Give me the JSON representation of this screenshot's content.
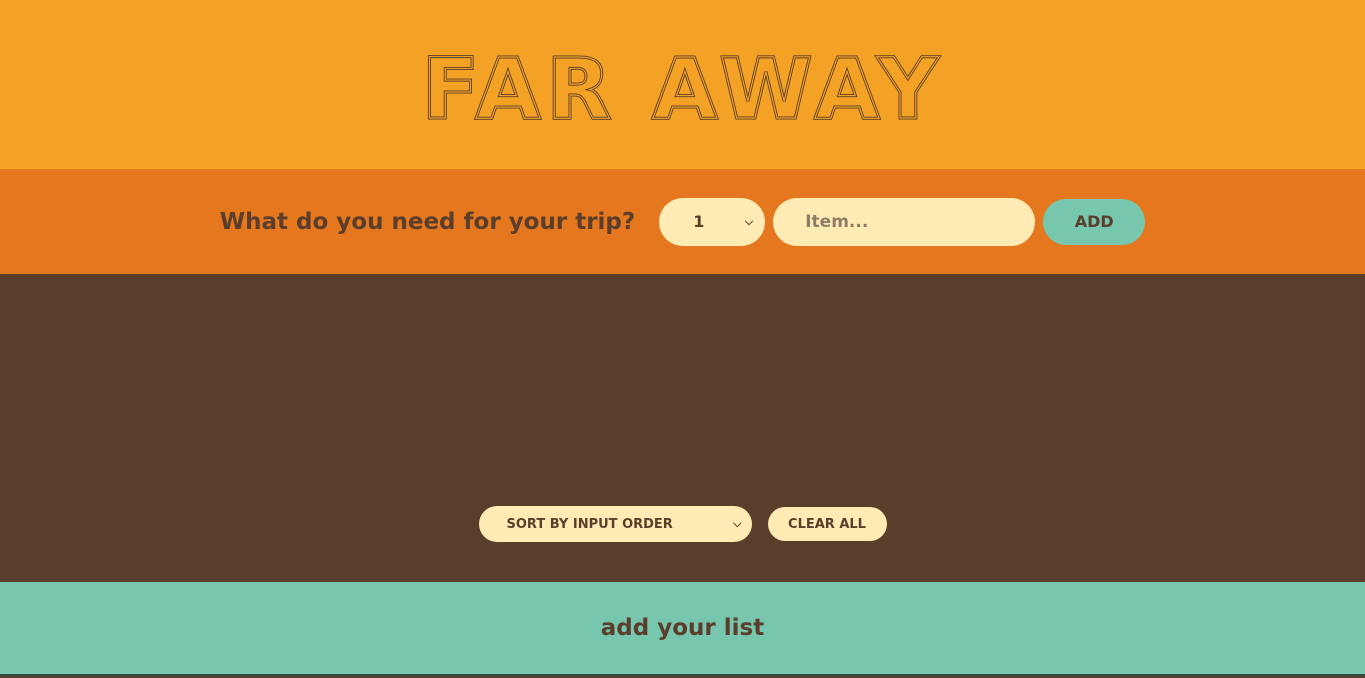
{
  "header": {
    "title": "FAR AWAY"
  },
  "add_form": {
    "question": "What do you need for your trip?",
    "quantity_value": "1",
    "item_placeholder": "Item...",
    "add_label": "ADD"
  },
  "list": {
    "sort_value": "SORT BY INPUT ORDER",
    "clear_label": "CLEAR ALL"
  },
  "stats": {
    "text": "add your list"
  },
  "colors": {
    "header_bg": "#f4a226",
    "form_bg": "#e5771f",
    "list_bg": "#5a3e2b",
    "stats_bg": "#76c7ad",
    "input_bg": "#ffebb3",
    "text": "#5a3e2b"
  },
  "icons": {
    "select_chevron": "chevron-down-icon"
  }
}
